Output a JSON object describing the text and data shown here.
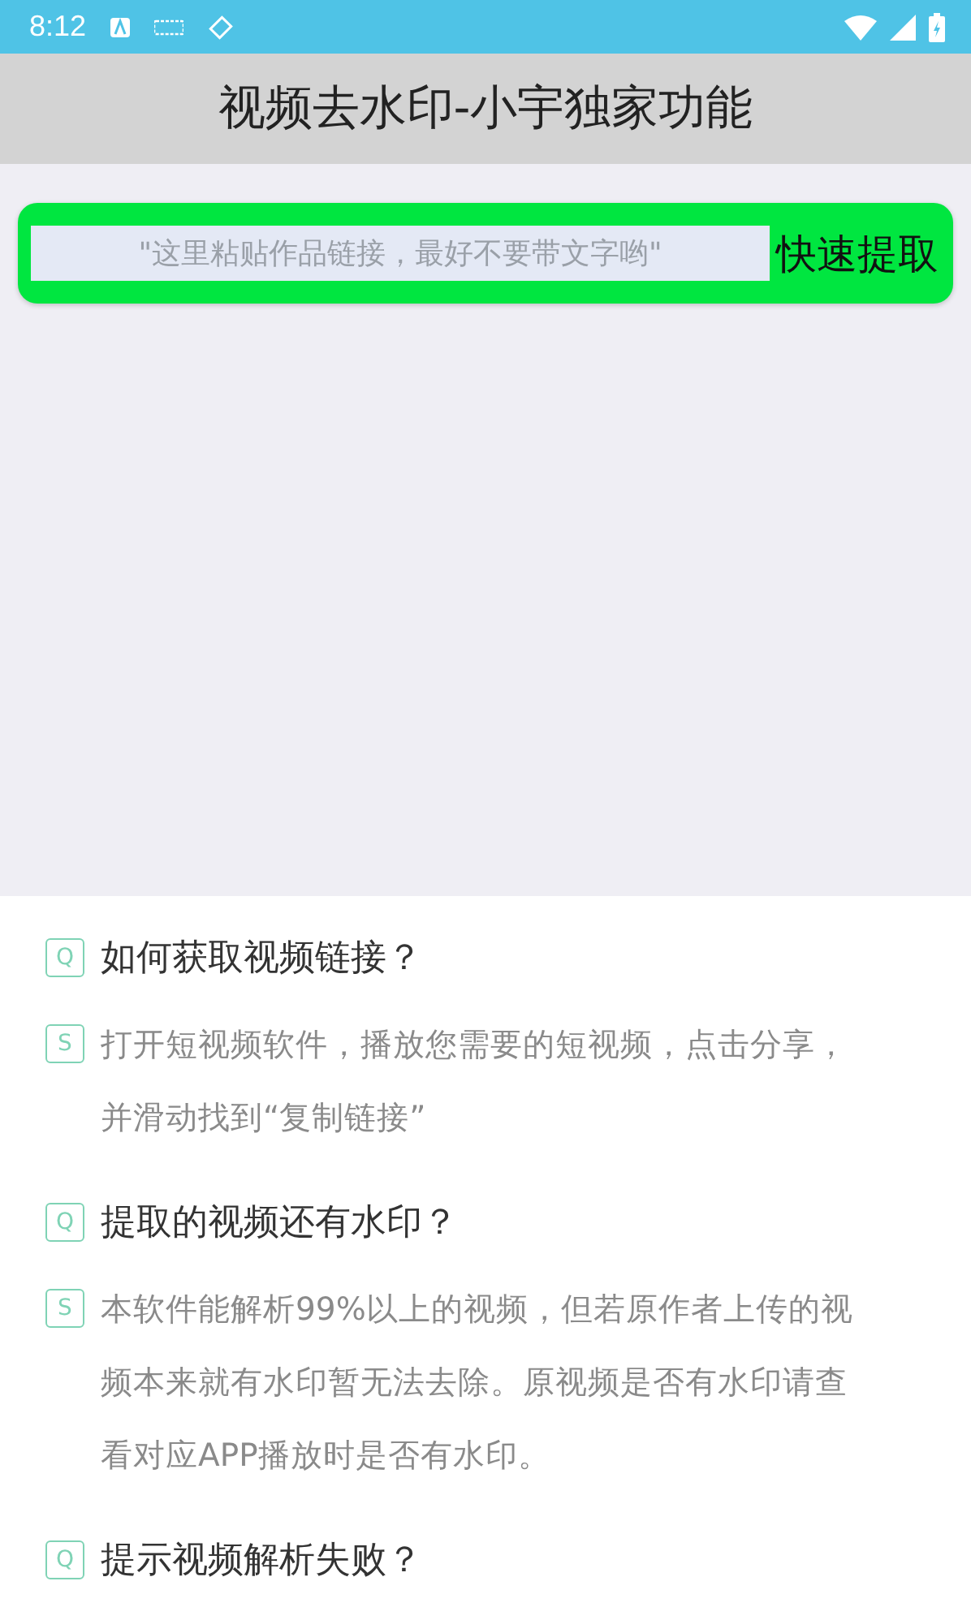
{
  "status_bar": {
    "time": "8:12"
  },
  "title": "视频去水印-小宇独家功能",
  "search": {
    "placeholder": "\"这里粘贴作品链接，最好不要带文字哟\"",
    "button": "快速提取"
  },
  "faq": [
    {
      "kind": "question",
      "badge": "Q",
      "lines": [
        "如何获取视频链接？"
      ]
    },
    {
      "kind": "answer",
      "badge": "S",
      "lines": [
        "打开短视频软件，播放您需要的短视频，点击分享，",
        "并滑动找到“复制链接”"
      ]
    },
    {
      "kind": "question",
      "badge": "Q",
      "lines": [
        "提取的视频还有水印？"
      ]
    },
    {
      "kind": "answer",
      "badge": "S",
      "lines": [
        "本软件能解析99%以上的视频，但若原作者上传的视",
        "频本来就有水印暂无法去除。原视频是否有水印请查",
        "看对应APP播放时是否有水印。"
      ]
    },
    {
      "kind": "question",
      "badge": "Q",
      "lines": [
        "提示视频解析失败？"
      ]
    }
  ]
}
